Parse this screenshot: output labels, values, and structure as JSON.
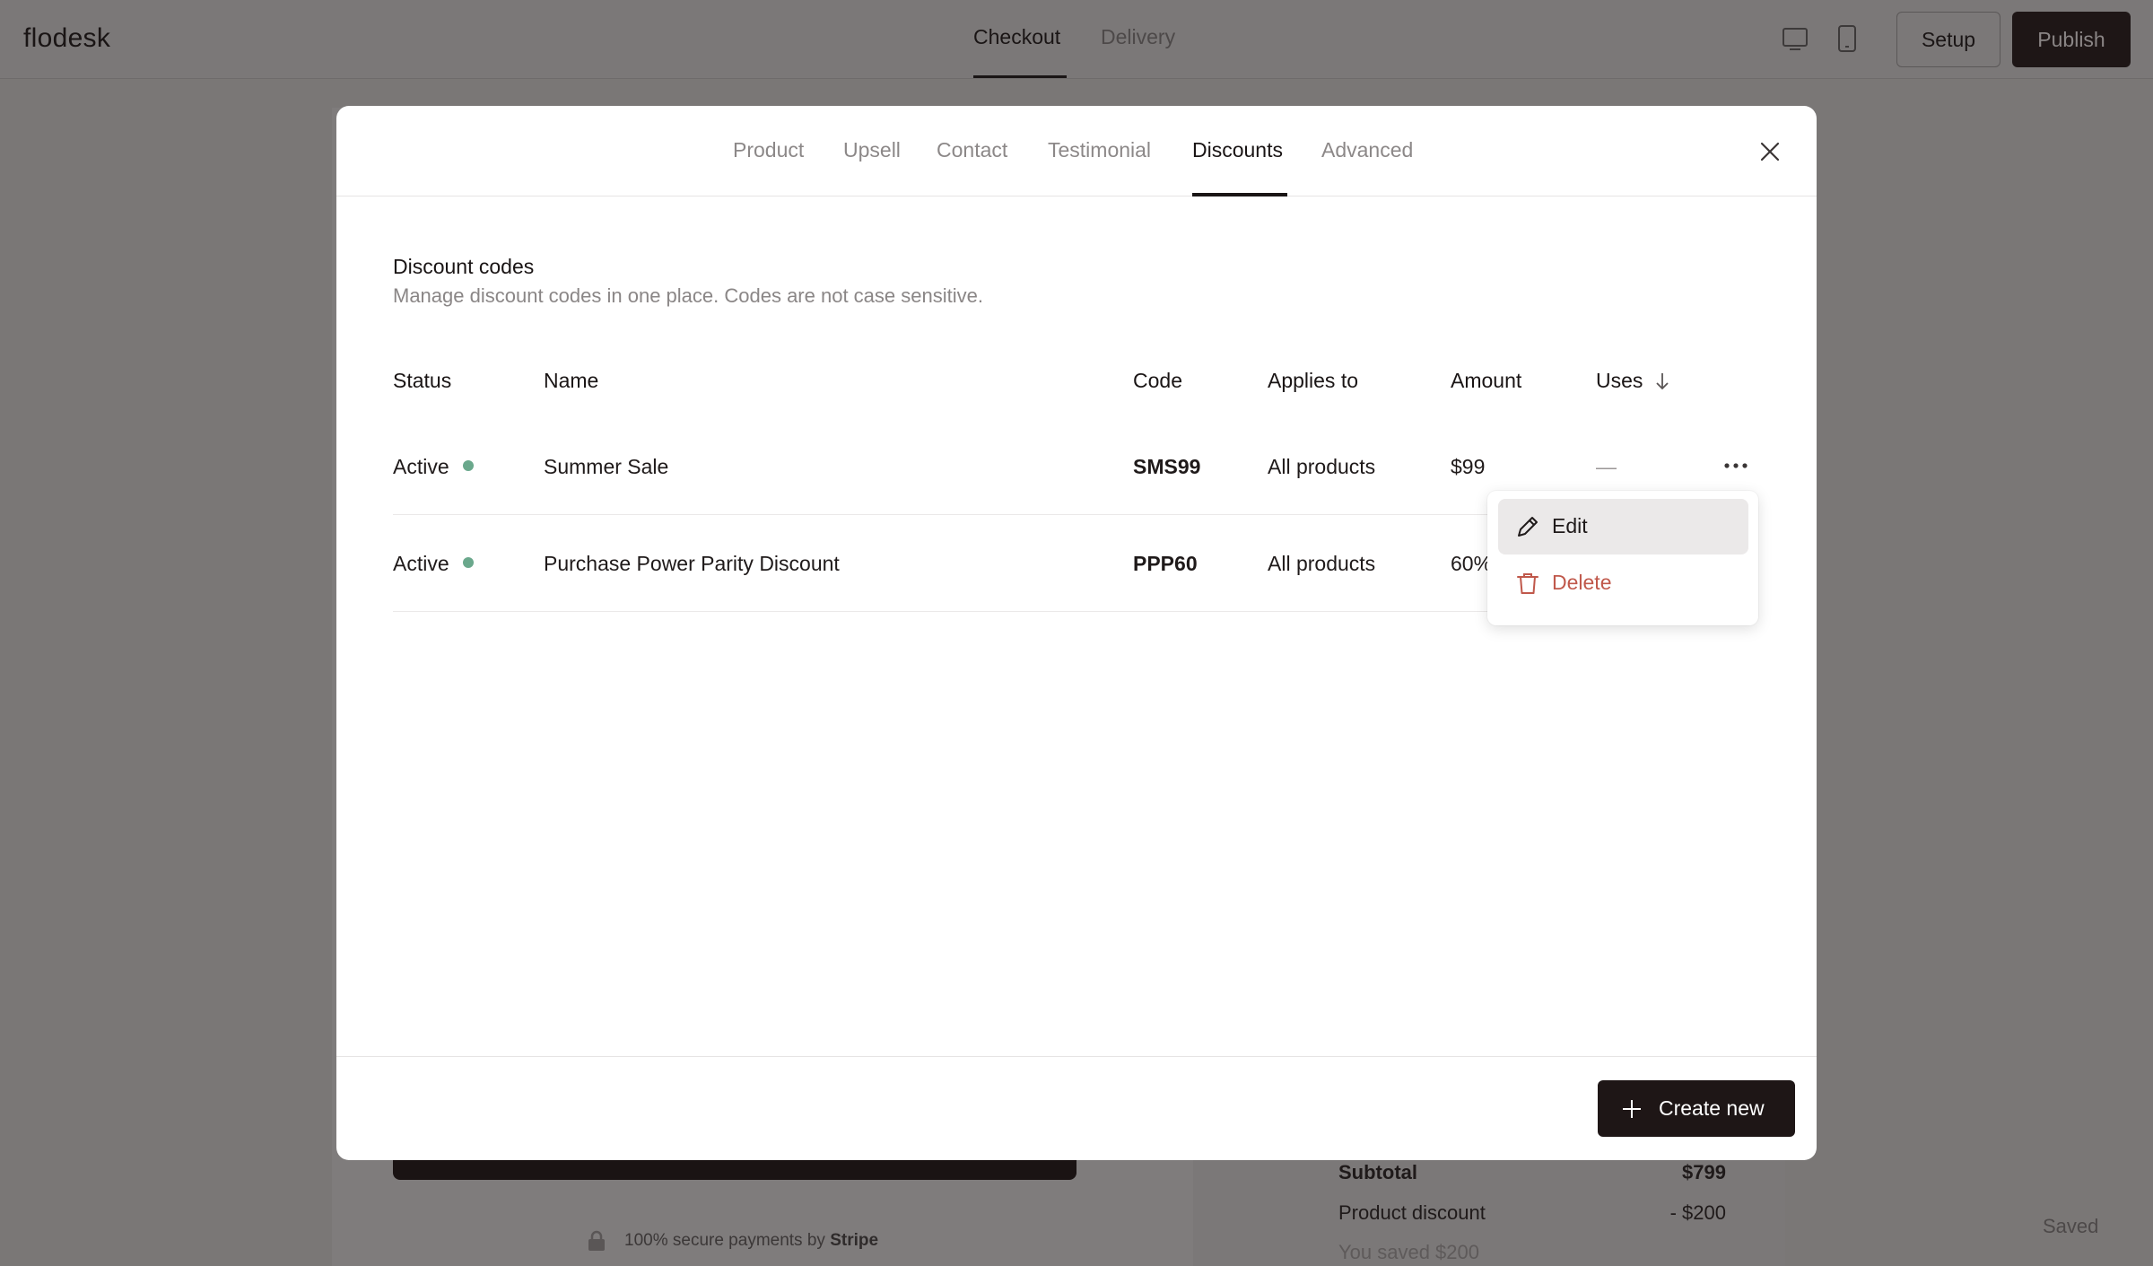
{
  "app": {
    "logo": "flodesk",
    "tabs": [
      {
        "label": "Checkout",
        "active": true
      },
      {
        "label": "Delivery",
        "active": false
      }
    ],
    "setup_label": "Setup",
    "publish_label": "Publish",
    "saved_status": "Saved"
  },
  "background": {
    "secure_text": "100% secure payments by ",
    "secure_brand": "Stripe",
    "summary": [
      {
        "label": "Subtotal",
        "value": "$799"
      },
      {
        "label": "Product discount",
        "value": "- $200"
      }
    ],
    "saved_note": "You saved $200"
  },
  "modal": {
    "tabs": [
      {
        "label": "Product"
      },
      {
        "label": "Upsell"
      },
      {
        "label": "Contact"
      },
      {
        "label": "Testimonial"
      },
      {
        "label": "Discounts",
        "active": true
      },
      {
        "label": "Advanced"
      }
    ],
    "section_title": "Discount codes",
    "section_desc": "Manage discount codes in one place. Codes are not case sensitive.",
    "table": {
      "headers": {
        "status": "Status",
        "name": "Name",
        "code": "Code",
        "applies_to": "Applies to",
        "amount": "Amount",
        "uses": "Uses"
      },
      "rows": [
        {
          "status": "Active",
          "name": "Summer Sale",
          "code": "SMS99",
          "applies_to": "All products",
          "amount": "$99",
          "uses": "—"
        },
        {
          "status": "Active",
          "name": "Purchase Power Parity Discount",
          "code": "PPP60",
          "applies_to": "All products",
          "amount": "60%"
        }
      ]
    },
    "menu": {
      "edit_label": "Edit",
      "delete_label": "Delete"
    },
    "create_label": "Create new"
  },
  "colors": {
    "accent_dark": "#1e1616",
    "status_active": "#6aa88c",
    "danger": "#c0584b"
  }
}
